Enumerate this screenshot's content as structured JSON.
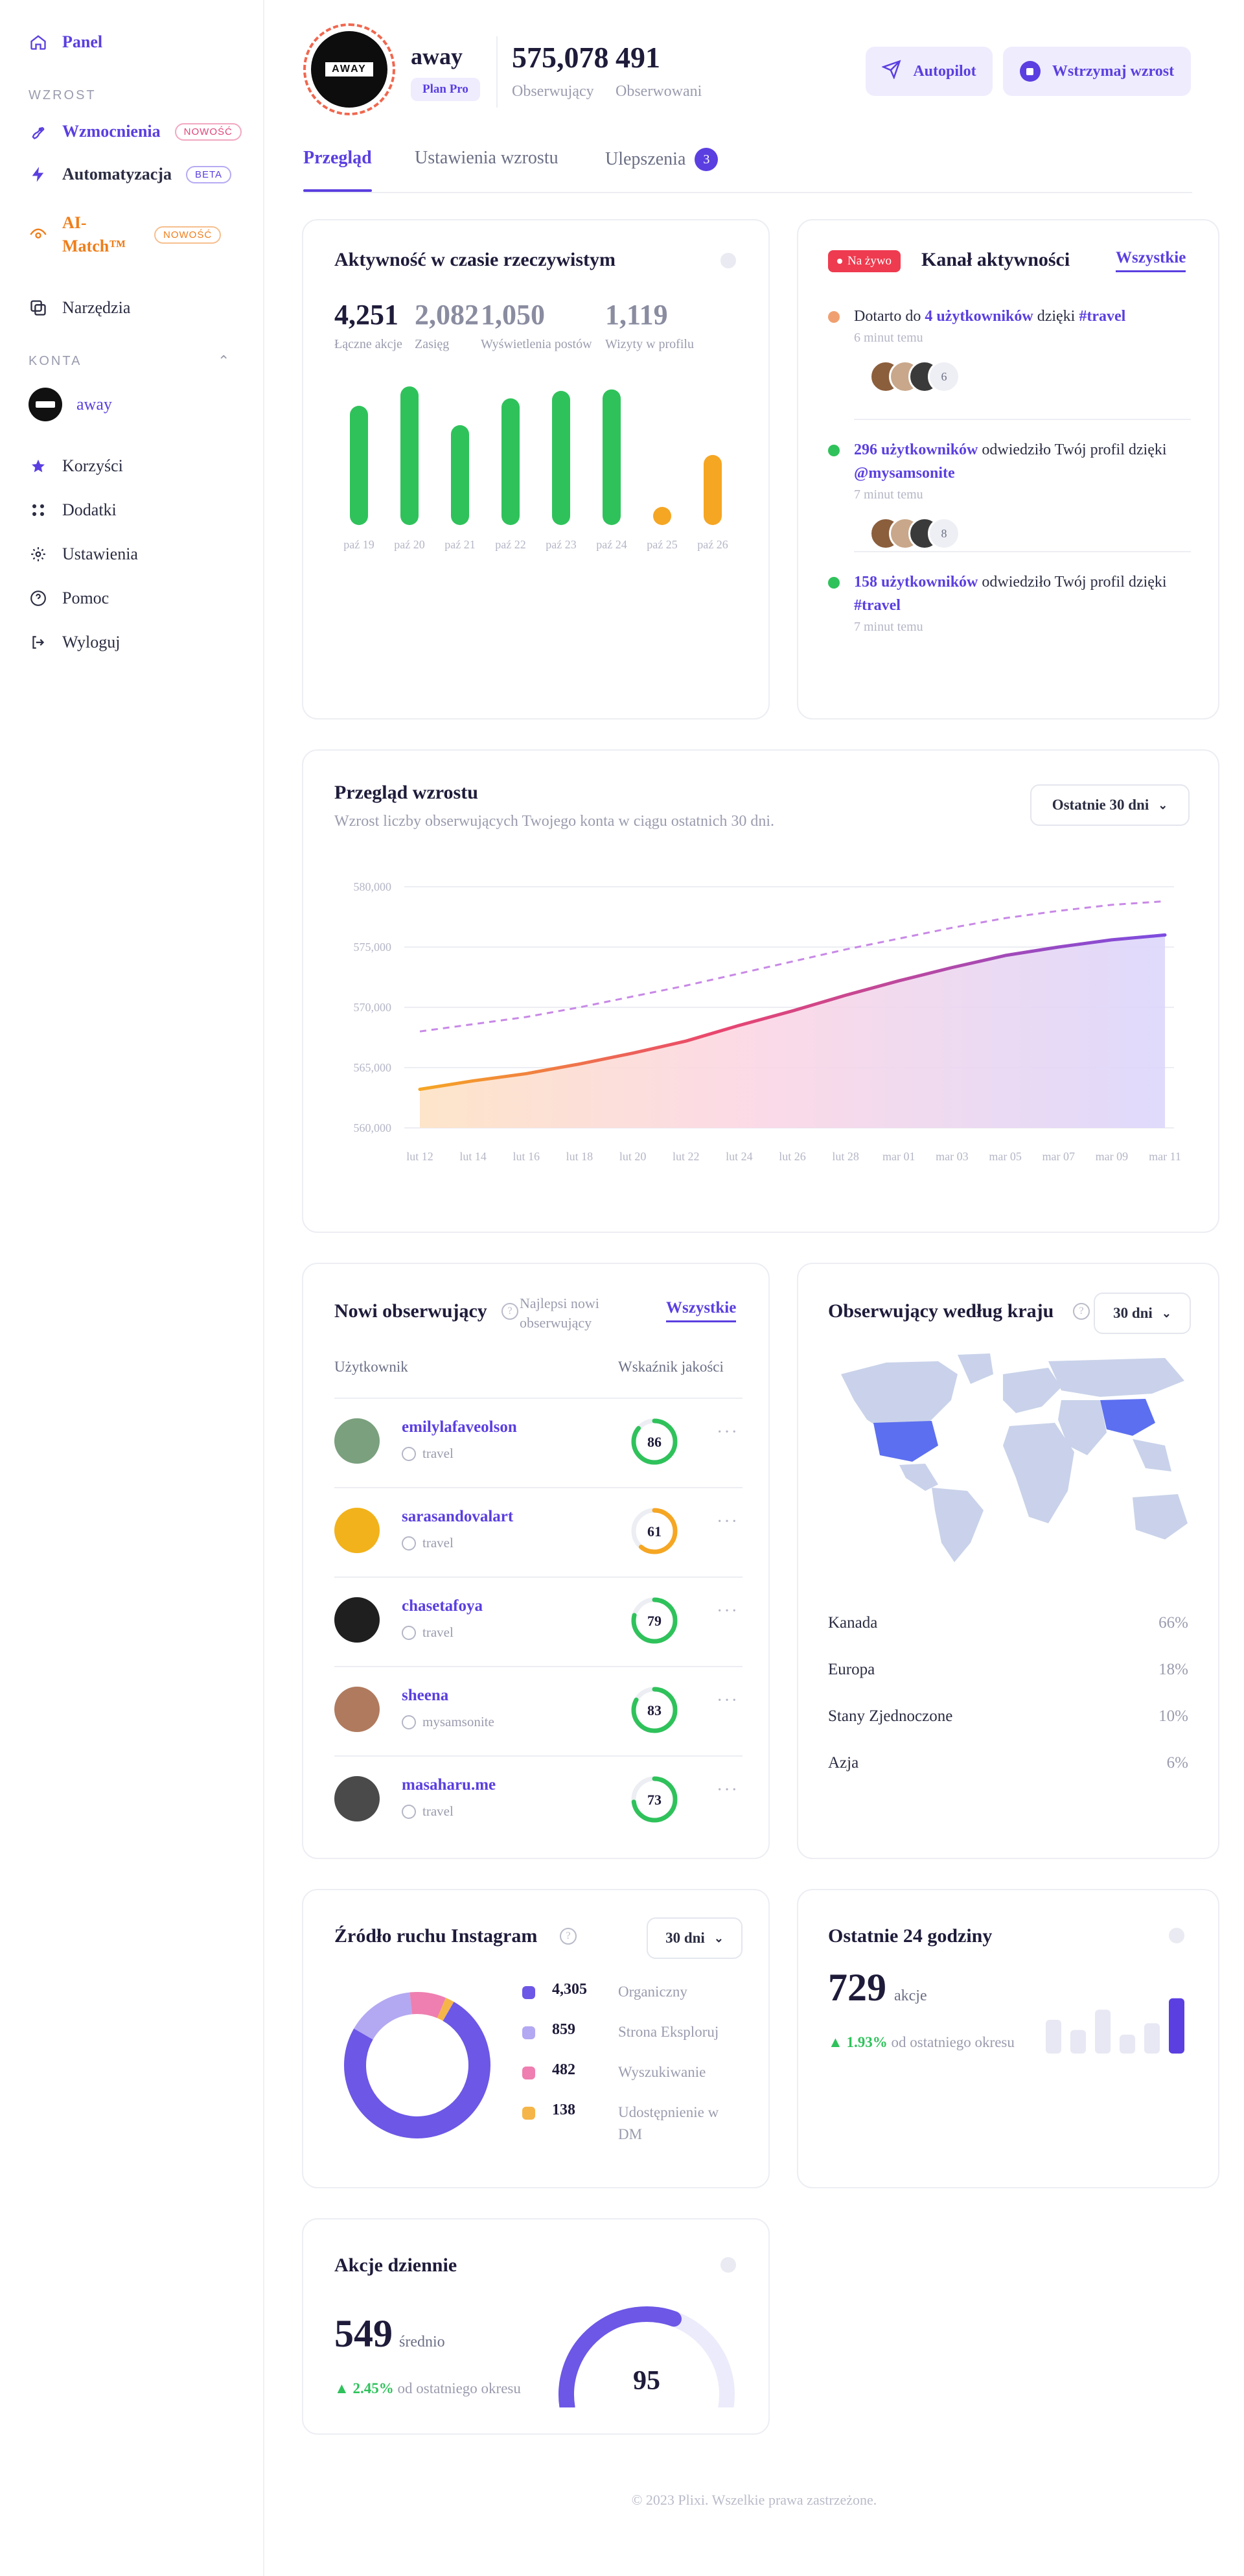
{
  "sidebar": {
    "panel": "Panel",
    "section_growth": "WZROST",
    "boosts": "Wzmocnienia",
    "boosts_tag": "NOWOŚĆ",
    "automation": "Automatyzacja",
    "automation_tag": "BETA",
    "ai_match": "AI-Match™",
    "ai_match_tag": "NOWOŚĆ",
    "tools": "Narzędzia",
    "section_accounts": "KONTA",
    "account_name": "away",
    "benefits": "Korzyści",
    "addons": "Dodatki",
    "settings": "Ustawienia",
    "help": "Pomoc",
    "logout": "Wyloguj"
  },
  "profile": {
    "logo_text": "AWAY",
    "name": "away",
    "plan": "Plan Pro",
    "followers_value": "575,078",
    "followers_label": "Obserwujący",
    "following_value": "491",
    "following_label": "Obserwowani",
    "autopilot": "Autopilot",
    "pause": "Wstrzymaj wzrost"
  },
  "tabs": [
    {
      "label": "Przegląd"
    },
    {
      "label": "Ustawienia wzrostu"
    },
    {
      "label": "Ulepszenia",
      "badge": "3"
    }
  ],
  "realtime": {
    "title": "Aktywność w czasie rzeczywistym",
    "stats": [
      {
        "value": "4,251",
        "label": "Łączne akcje"
      },
      {
        "value": "2,082",
        "label": "Zasięg"
      },
      {
        "value": "1,050",
        "label": "Wyświetlenia postów"
      },
      {
        "value": "1,119",
        "label": "Wizyty w profilu"
      }
    ],
    "bars": [
      {
        "day": "paź 19",
        "level": 0.8,
        "color": "#2fc25b"
      },
      {
        "day": "paź 20",
        "level": 0.93,
        "color": "#2fc25b"
      },
      {
        "day": "paź 21",
        "level": 0.67,
        "color": "#2fc25b"
      },
      {
        "day": "paź 22",
        "level": 0.85,
        "color": "#2fc25b"
      },
      {
        "day": "paź 23",
        "level": 0.9,
        "color": "#2fc25b"
      },
      {
        "day": "paź 24",
        "level": 0.91,
        "color": "#2fc25b"
      },
      {
        "day": "paź 25",
        "level": 0.12,
        "color": "#f5a623"
      },
      {
        "day": "paź 26",
        "level": 0.47,
        "color": "#f5a623"
      }
    ]
  },
  "feed": {
    "live": "Na żywo",
    "title": "Kanał aktywności",
    "all": "Wszystkie",
    "items": [
      {
        "dot": "#f0a070",
        "pre": "Dotarto do ",
        "hl1": "4 użytkowników",
        "mid": " dzięki ",
        "hl2": "#travel",
        "time": "6 minut temu",
        "count": "6"
      },
      {
        "dot": "#2fc25b",
        "pre": "",
        "hl1": "296 użytkowników",
        "mid": " odwiedziło Twój profil dzięki ",
        "hl2": "@mysamsonite",
        "time": "7 minut temu",
        "count": "8"
      },
      {
        "dot": "#2fc25b",
        "pre": "",
        "hl1": "158 użytkowników",
        "mid": " odwiedziło Twój profil dzięki ",
        "hl2": "#travel",
        "time": "7 minut temu",
        "count": ""
      }
    ]
  },
  "growth": {
    "title": "Przegląd wzrostu",
    "subtitle": "Wzrost liczby obserwujących Twojego konta w ciągu ostatnich 30 dni.",
    "range": "Ostatnie 30 dni"
  },
  "chart_data": {
    "type": "area",
    "title": "Przegląd wzrostu",
    "x": [
      "lut 12",
      "lut 14",
      "lut 16",
      "lut 18",
      "lut 20",
      "lut 22",
      "lut 24",
      "lut 26",
      "lut 28",
      "mar 01",
      "mar 03",
      "mar 05",
      "mar 07",
      "mar 09",
      "mar 11"
    ],
    "y_ticks": [
      "580,000",
      "575,000",
      "570,000",
      "565,000",
      "560,000"
    ],
    "ylim": [
      560000,
      580000
    ],
    "series": [
      {
        "values": [
          563200,
          563900,
          564500,
          565300,
          566200,
          567200,
          568500,
          569700,
          571000,
          572200,
          573300,
          574300,
          575000,
          575600,
          576000
        ],
        "style": "solid"
      },
      {
        "values": [
          568000,
          568600,
          569200,
          570000,
          570900,
          571800,
          572800,
          573800,
          574800,
          575700,
          576600,
          577400,
          578000,
          578500,
          578800
        ],
        "style": "dashed"
      }
    ],
    "grid": true
  },
  "new_followers": {
    "title": "Nowi obserwujący",
    "best": "Najlepsi nowi obserwujący",
    "all": "Wszystkie",
    "col_user": "Użytkownik",
    "col_quality": "Wskaźnik jakości",
    "rows": [
      {
        "name": "emilylafaveolson",
        "source": "travel",
        "score": "86",
        "pct": 0.86,
        "color": "#2fc25b"
      },
      {
        "name": "sarasandovalart",
        "source": "travel",
        "score": "61",
        "pct": 0.61,
        "color": "#f5a623"
      },
      {
        "name": "chasetafoya",
        "source": "travel",
        "score": "79",
        "pct": 0.79,
        "color": "#2fc25b"
      },
      {
        "name": "sheena",
        "source": "mysamsonite",
        "score": "83",
        "pct": 0.83,
        "color": "#2fc25b"
      },
      {
        "name": "masaharu.me",
        "source": "travel",
        "score": "73",
        "pct": 0.73,
        "color": "#2fc25b"
      }
    ]
  },
  "countries": {
    "title": "Obserwujący według kraju",
    "range": "30 dni",
    "rows": [
      {
        "name": "Kanada",
        "pct": "66%"
      },
      {
        "name": "Europa",
        "pct": "18%"
      },
      {
        "name": "Stany Zjednoczone",
        "pct": "10%"
      },
      {
        "name": "Azja",
        "pct": "6%"
      }
    ]
  },
  "traffic": {
    "title": "Źródło ruchu Instagram",
    "range": "30 dni",
    "items": [
      {
        "value": "4,305",
        "label": "Organiczny",
        "color": "#6c57e6",
        "share": 0.75
      },
      {
        "value": "859",
        "label": "Strona Eksploruj",
        "color": "#b3a8f2",
        "share": 0.15
      },
      {
        "value": "482",
        "label": "Wyszukiwanie",
        "color": "#ee7fb0",
        "share": 0.08
      },
      {
        "value": "138",
        "label": "Udostępnienie w DM",
        "color": "#f5b549",
        "share": 0.02
      }
    ]
  },
  "last24": {
    "title": "Ostatnie 24 godziny",
    "value": "729",
    "unit": "akcje",
    "change": "▲ 1.93%",
    "change_note": "od ostatniego okresu",
    "bars": [
      0.5,
      0.35,
      0.65,
      0.28,
      0.45,
      0.82
    ]
  },
  "daily": {
    "title": "Akcje dziennie",
    "value": "549",
    "unit": "średnio",
    "change": "▲ 2.45%",
    "change_note": "od ostatniego okresu",
    "gauge": "95",
    "gauge_pct": 0.6
  },
  "footer": "© 2023 Plixi. Wszelkie prawa zastrzeżone."
}
